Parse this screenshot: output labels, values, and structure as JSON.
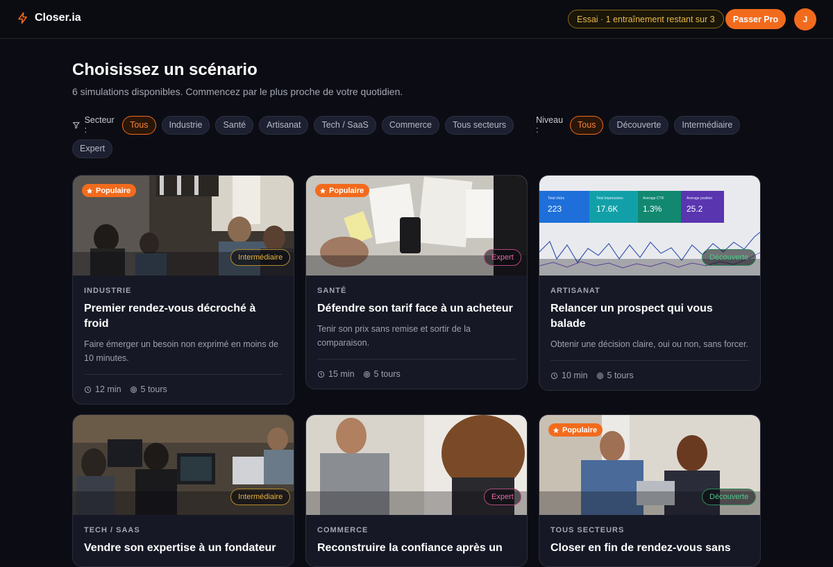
{
  "app": {
    "name": "Closer.ia"
  },
  "header": {
    "trial_text": "Essai · 1 entraînement restant sur 3",
    "pro_button": "Passer Pro",
    "avatar_initial": "J"
  },
  "page": {
    "title": "Choisissez un scénario",
    "subtitle": "6 simulations disponibles. Commencez par le plus proche de votre quotidien."
  },
  "filters": {
    "sector_label": "Secteur :",
    "sectors": [
      "Tous",
      "Industrie",
      "Santé",
      "Artisanat",
      "Tech / SaaS",
      "Commerce",
      "Tous secteurs"
    ],
    "sector_selected": "Tous",
    "level_label": "Niveau :",
    "levels": [
      "Tous",
      "Découverte",
      "Intermédiaire",
      "Expert"
    ],
    "level_selected": "Tous"
  },
  "cards": [
    {
      "sector": "INDUSTRIE",
      "title": "Premier rendez-vous décroché à froid",
      "description": "Faire émerger un besoin non exprimé en moins de 10 minutes.",
      "duration": "12 min",
      "turns": "5 tours",
      "level": "Intermédiaire",
      "popular": true,
      "popular_label": "Populaire"
    },
    {
      "sector": "SANTÉ",
      "title": "Défendre son tarif face à un acheteur",
      "description": "Tenir son prix sans remise et sortir de la comparaison.",
      "duration": "15 min",
      "turns": "5 tours",
      "level": "Expert",
      "popular": true,
      "popular_label": "Populaire"
    },
    {
      "sector": "ARTISANAT",
      "title": "Relancer un prospect qui vous balade",
      "description": "Obtenir une décision claire, oui ou non, sans forcer.",
      "duration": "10 min",
      "turns": "5 tours",
      "level": "Découverte",
      "popular": false,
      "image_stats": [
        {
          "label": "Total clicks",
          "value": "223"
        },
        {
          "label": "Total impressions",
          "value": "17.6K"
        },
        {
          "label": "Average CTR",
          "value": "1.3%"
        },
        {
          "label": "Average position",
          "value": "25.2"
        }
      ]
    },
    {
      "sector": "TECH / SAAS",
      "title": "Vendre son expertise à un fondateur",
      "level": "Intermédiaire",
      "popular": false
    },
    {
      "sector": "COMMERCE",
      "title": "Reconstruire la confiance après un",
      "level": "Expert",
      "popular": false
    },
    {
      "sector": "TOUS SECTEURS",
      "title": "Closer en fin de rendez-vous sans",
      "level": "Découverte",
      "popular": true,
      "popular_label": "Populaire"
    }
  ],
  "colors": {
    "accent": "#f26b1d",
    "background": "#0c0d14",
    "card": "#161925",
    "intermediate": "#e6b440",
    "expert": "#e56aa8",
    "discovery": "#4cc98a"
  }
}
